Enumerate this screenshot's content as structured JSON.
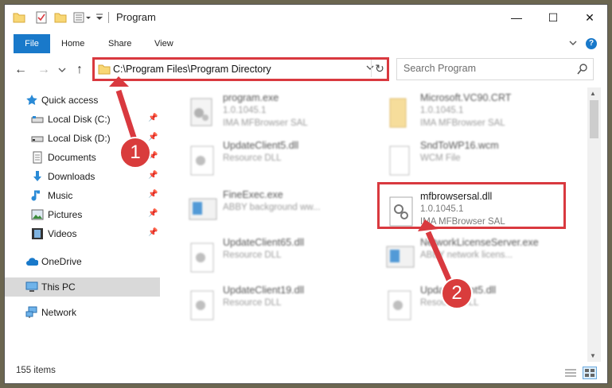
{
  "window": {
    "title": "Program",
    "controls": [
      "—",
      "☐",
      "✕"
    ]
  },
  "ribbon": {
    "tabs": [
      "File",
      "Home",
      "Share",
      "View"
    ],
    "help": "?"
  },
  "nav": {
    "address": "C:\\Program Files\\Program Directory",
    "search_placeholder": "Search Program"
  },
  "sidebar": {
    "items": [
      {
        "label": "Quick access",
        "icon": "star-icon",
        "pinned": false
      },
      {
        "label": "Local Disk (C:)",
        "icon": "drive-icon",
        "pinned": true
      },
      {
        "label": "Local Disk (D:)",
        "icon": "drive-icon",
        "pinned": true
      },
      {
        "label": "Documents",
        "icon": "documents-icon",
        "pinned": true
      },
      {
        "label": "Downloads",
        "icon": "download-icon",
        "pinned": true
      },
      {
        "label": "Music",
        "icon": "music-icon",
        "pinned": true
      },
      {
        "label": "Pictures",
        "icon": "pictures-icon",
        "pinned": true
      },
      {
        "label": "Videos",
        "icon": "videos-icon",
        "pinned": true
      },
      {
        "label": "OneDrive",
        "icon": "cloud-icon",
        "pinned": false
      },
      {
        "label": "This PC",
        "icon": "computer-icon",
        "pinned": false,
        "selected": true
      },
      {
        "label": "Network",
        "icon": "network-icon",
        "pinned": false
      }
    ]
  },
  "files": [
    {
      "name": "program.exe",
      "line2": "1.0.1045.1",
      "line3": "IMA MFBrowser SAL",
      "icon": "exe-icon"
    },
    {
      "name": "Microsoft.VC90.CRT",
      "line2": "1.0.1045.1",
      "line3": "IMA MFBrowser SAL",
      "icon": "folder-icon"
    },
    {
      "name": "UpdateClient5.dll",
      "line2": "Resource DLL",
      "line3": "",
      "icon": "dll-icon"
    },
    {
      "name": "SndToWP16.wcm",
      "line2": "WCM File",
      "line3": "",
      "icon": "file-icon"
    },
    {
      "name": "FineExec.exe",
      "line2": "ABBY background ww...",
      "line3": "",
      "icon": "app-icon"
    },
    {
      "name": "mfbrowsersal.dll",
      "line2": "1.0.1045.1",
      "line3": "IMA MFBrowser SAL",
      "icon": "dll-icon",
      "highlighted": true
    },
    {
      "name": "UpdateClient65.dll",
      "line2": "Resource DLL",
      "line3": "",
      "icon": "dll-icon"
    },
    {
      "name": "NetworkLicenseServer.exe",
      "line2": "ABBY network licens...",
      "line3": "",
      "icon": "app-icon"
    },
    {
      "name": "UpdateClient19.dll",
      "line2": "Resource DLL",
      "line3": "",
      "icon": "dll-icon"
    },
    {
      "name": "UpdateClient5.dll",
      "line2": "Resource DLL",
      "line3": "",
      "icon": "dll-icon"
    }
  ],
  "status": {
    "count": "155 items"
  },
  "callouts": [
    "1",
    "2"
  ],
  "colors": {
    "accent": "#1979ca",
    "callout": "#d9393f",
    "selection": "#d9d9d9"
  }
}
